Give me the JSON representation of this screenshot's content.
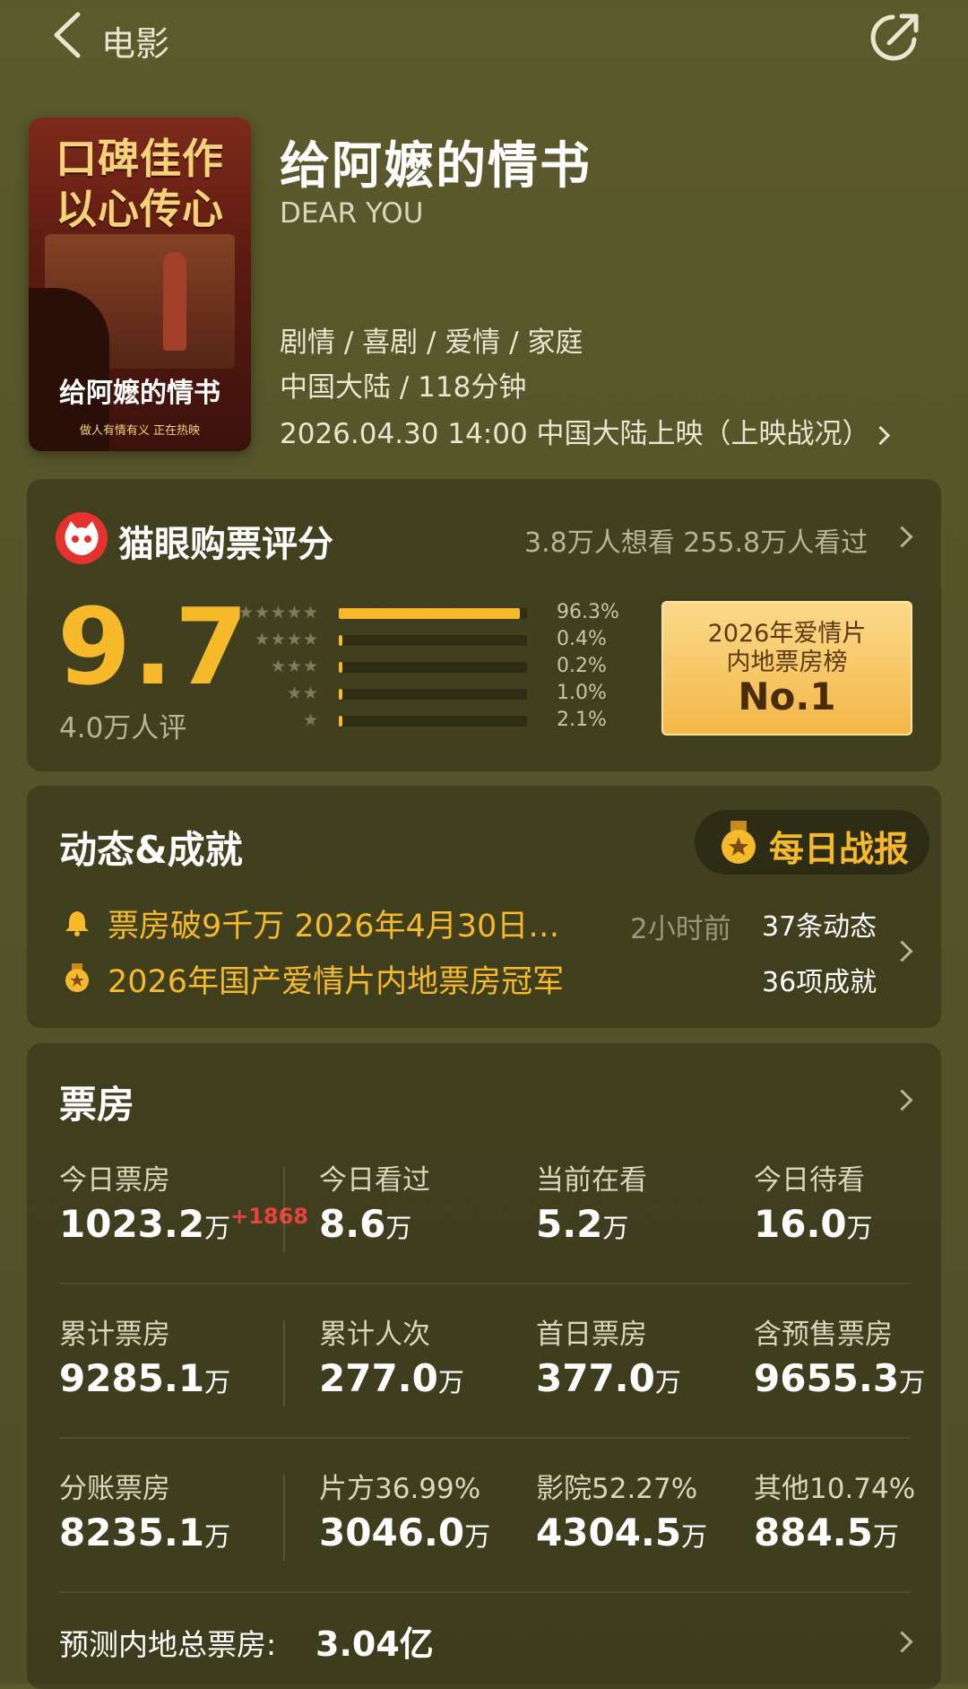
{
  "topbar": {
    "title": "电影"
  },
  "poster": {
    "line1": "口碑佳作",
    "line2": "以心传心",
    "name": "给阿嬷的情书",
    "tagline": "做人有情有义 正在热映"
  },
  "movie": {
    "title": "给阿嬷的情书",
    "english_title": "DEAR YOU",
    "genres": "剧情 / 喜剧 / 爱情 / 家庭",
    "region_duration": "中国大陆 / 118分钟",
    "release": "2026.04.30 14:00 中国大陆上映（上映战况）"
  },
  "rating": {
    "header": "猫眼购票评分",
    "want_seen": "3.8万人想看 255.8万人看过",
    "score": "9.7",
    "count": "4.0万人评",
    "distribution": [
      {
        "stars": "★★★★★",
        "percent": "96.3%",
        "value": 0.963
      },
      {
        "stars": "★★★★",
        "percent": "0.4%",
        "value": 0.004
      },
      {
        "stars": "★★★",
        "percent": "0.2%",
        "value": 0.002
      },
      {
        "stars": "★★",
        "percent": "1.0%",
        "value": 0.01
      },
      {
        "stars": "★",
        "percent": "2.1%",
        "value": 0.021
      }
    ],
    "rank": {
      "line1": "2026年爱情片",
      "line2": "内地票房榜",
      "no": "No.1"
    }
  },
  "dynamics": {
    "title": "动态&成就",
    "daily_button": "每日战报",
    "items": [
      {
        "text": "票房破9千万 2026年4月30日…",
        "time": "2小时前",
        "count": "37条动态",
        "icon": "bell-icon"
      },
      {
        "text": "2026年国产爱情片内地票房冠军",
        "count": "36项成就",
        "icon": "medal-icon"
      }
    ]
  },
  "boxoffice": {
    "title": "票房",
    "rows": [
      [
        {
          "label": "今日票房",
          "value": "1023.2",
          "unit": "万",
          "delta": "+1868"
        },
        {
          "label": "今日看过",
          "value": "8.6",
          "unit": "万"
        },
        {
          "label": "当前在看",
          "value": "5.2",
          "unit": "万"
        },
        {
          "label": "今日待看",
          "value": "16.0",
          "unit": "万"
        }
      ],
      [
        {
          "label": "累计票房",
          "value": "9285.1",
          "unit": "万"
        },
        {
          "label": "累计人次",
          "value": "277.0",
          "unit": "万"
        },
        {
          "label": "首日票房",
          "value": "377.0",
          "unit": "万"
        },
        {
          "label": "含预售票房",
          "value": "9655.3",
          "unit": "万"
        }
      ],
      [
        {
          "label": "分账票房",
          "value": "8235.1",
          "unit": "万"
        },
        {
          "label": "片方36.99%",
          "value": "3046.0",
          "unit": "万"
        },
        {
          "label": "影院52.27%",
          "value": "4304.5",
          "unit": "万"
        },
        {
          "label": "其他10.74%",
          "value": "884.5",
          "unit": "万"
        }
      ]
    ],
    "predict_label": "预测内地总票房:",
    "predict_value": "3.04亿"
  },
  "colors": {
    "accent": "#f5b92a",
    "background": "#55542a",
    "delta": "#e8423a"
  }
}
